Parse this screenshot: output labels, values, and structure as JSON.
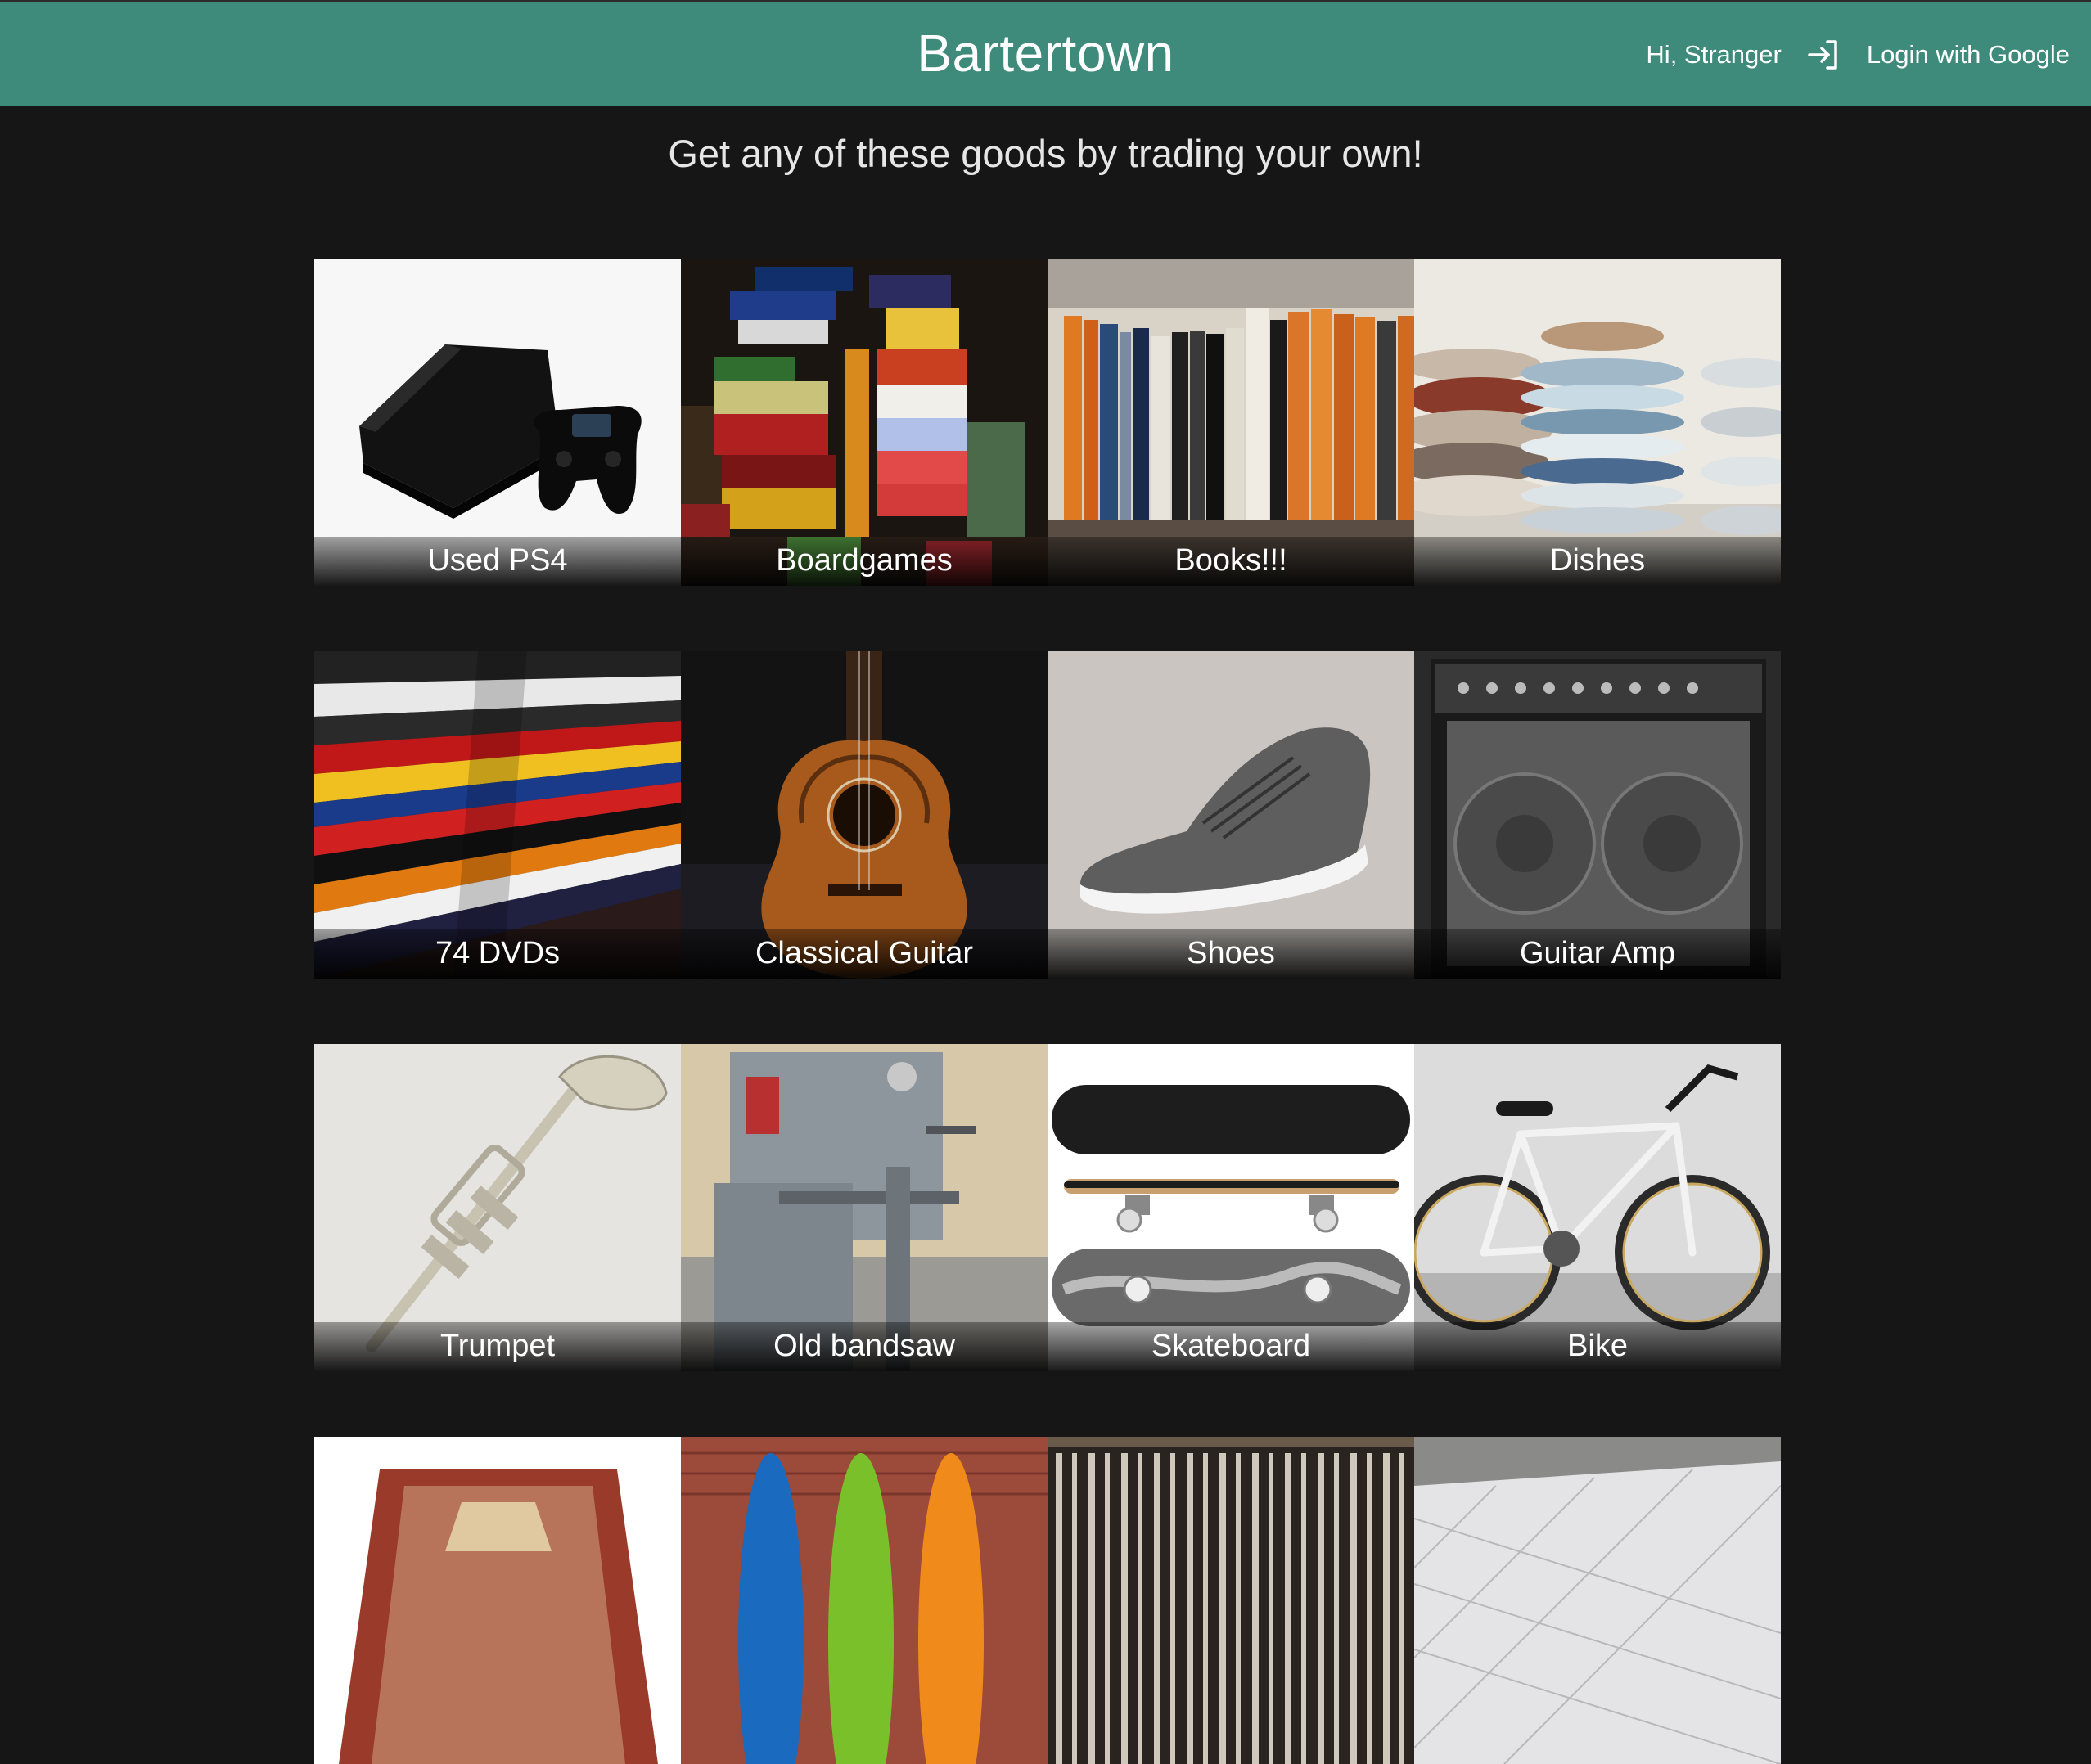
{
  "header": {
    "title": "Bartertown",
    "greeting": "Hi, Stranger",
    "login_label": "Login with Google",
    "login_icon": "sign-in-icon",
    "background": "#3e8a7b"
  },
  "tagline": "Get any of these goods by trading your own!",
  "items": [
    {
      "label": "Used PS4"
    },
    {
      "label": "Boardgames"
    },
    {
      "label": "Books!!!"
    },
    {
      "label": "Dishes"
    },
    {
      "label": "74 DVDs"
    },
    {
      "label": "Classical Guitar"
    },
    {
      "label": "Shoes"
    },
    {
      "label": "Guitar Amp"
    },
    {
      "label": "Trumpet"
    },
    {
      "label": "Old bandsaw"
    },
    {
      "label": "Skateboard"
    },
    {
      "label": "Bike"
    },
    {
      "label": ""
    },
    {
      "label": ""
    },
    {
      "label": ""
    },
    {
      "label": ""
    }
  ]
}
